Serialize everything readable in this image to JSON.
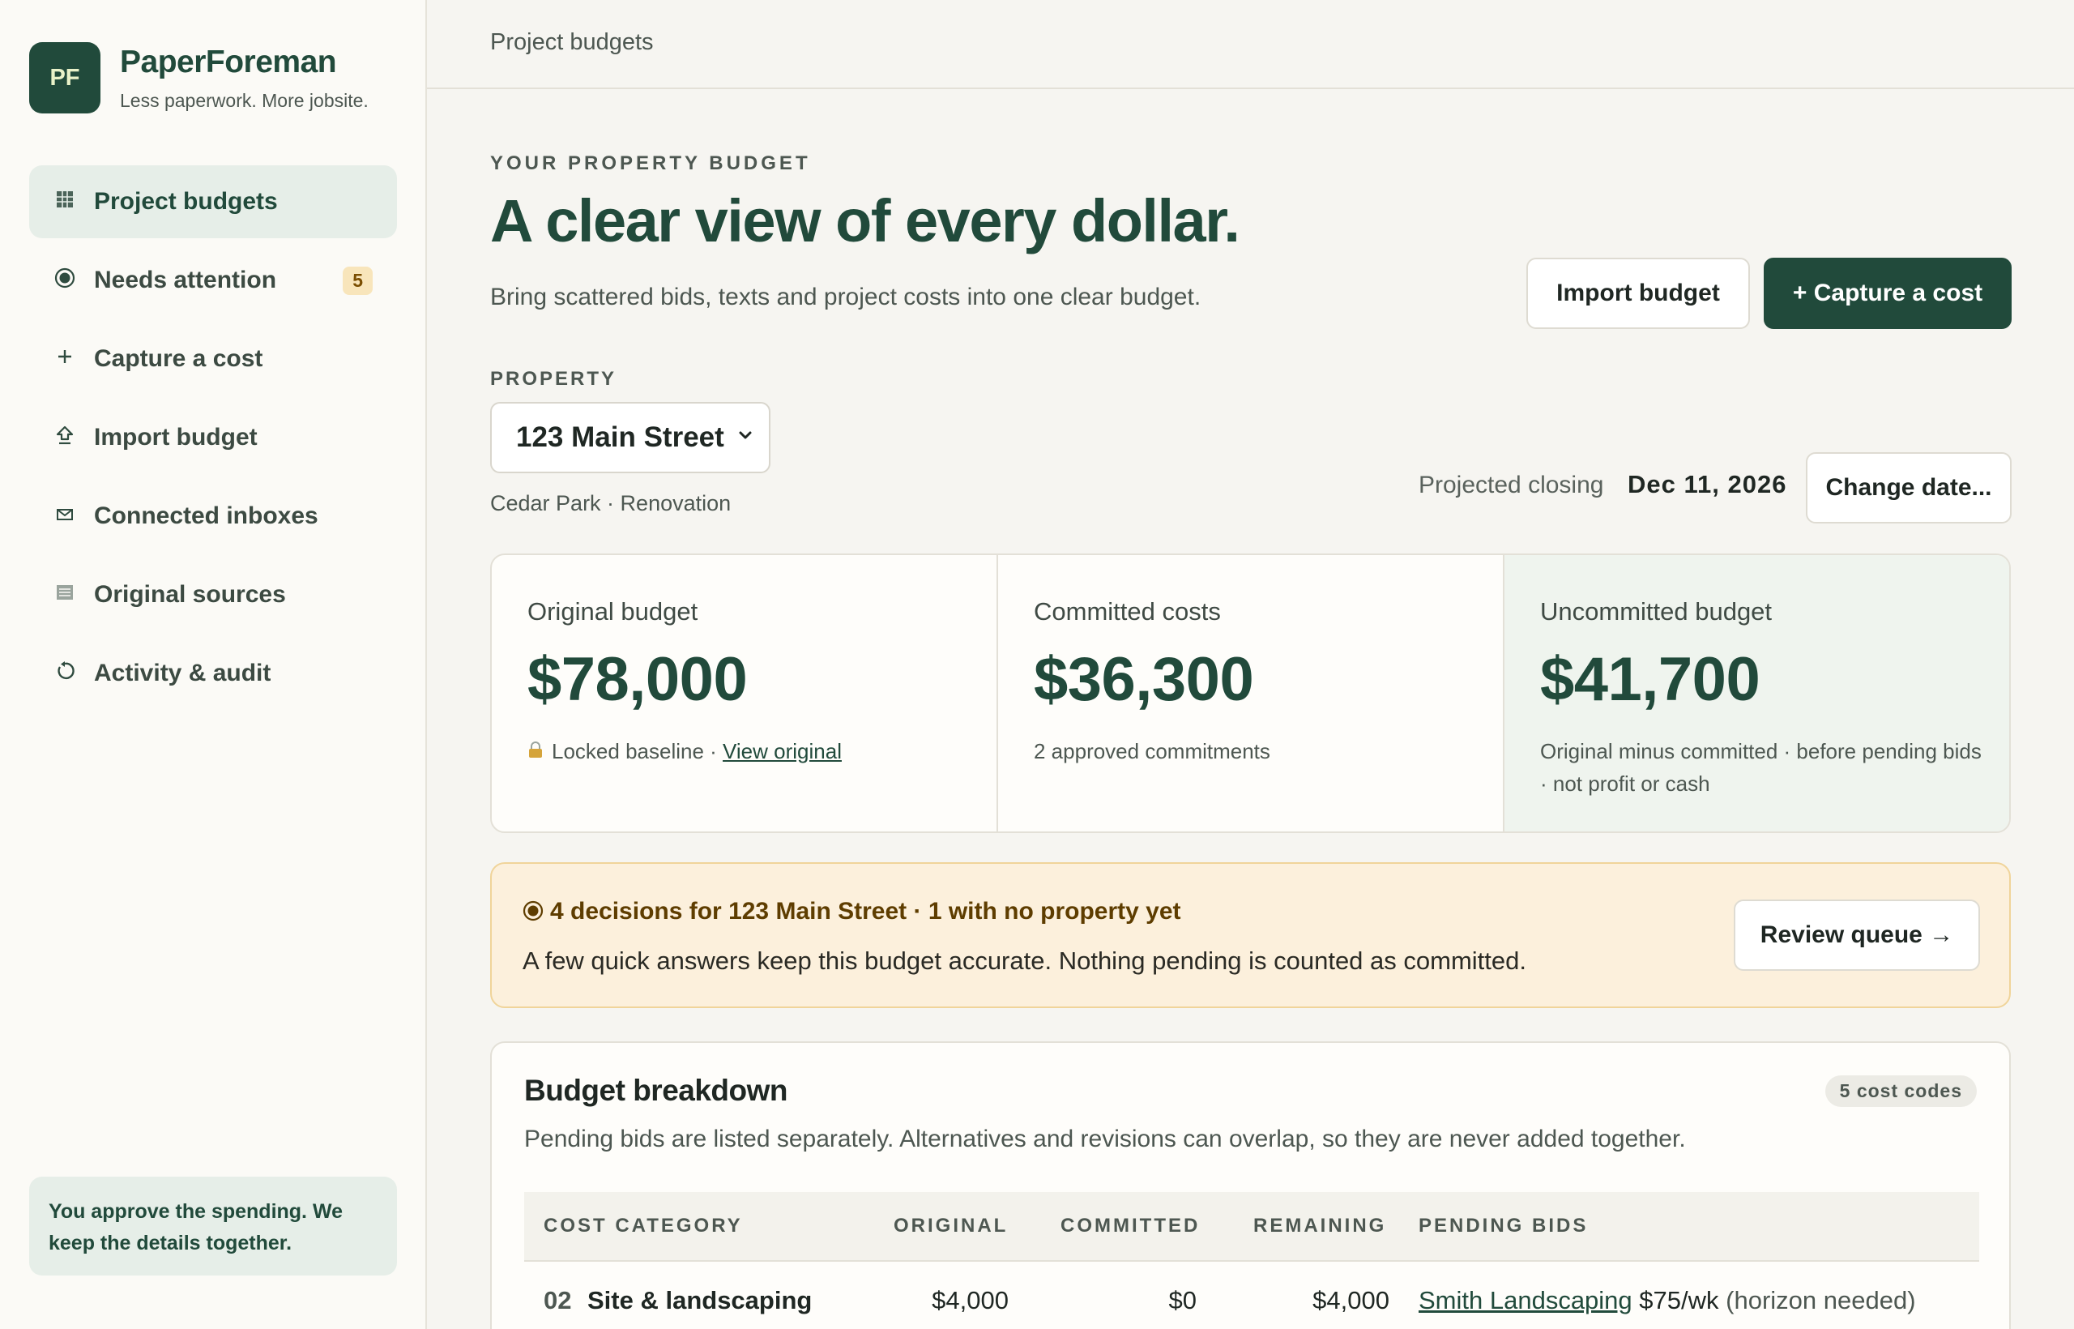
{
  "brand": {
    "initials": "PF",
    "name": "PaperForeman",
    "tagline": "Less paperwork. More jobsite."
  },
  "nav": [
    {
      "label": "Project budgets",
      "icon": "grid-icon",
      "active": true
    },
    {
      "label": "Needs attention",
      "icon": "target-icon",
      "badge": "5"
    },
    {
      "label": "Capture a cost",
      "icon": "plus-icon"
    },
    {
      "label": "Import budget",
      "icon": "upload-icon"
    },
    {
      "label": "Connected inboxes",
      "icon": "envelope-icon"
    },
    {
      "label": "Original sources",
      "icon": "document-icon"
    },
    {
      "label": "Activity & audit",
      "icon": "history-icon"
    }
  ],
  "sidebar_note": "You approve the spending. We keep the details together.",
  "topbar": {
    "title": "Project budgets"
  },
  "hero": {
    "eyebrow": "YOUR PROPERTY BUDGET",
    "headline": "A clear view of every dollar.",
    "subline": "Bring scattered bids, texts and project costs into one clear budget.",
    "import_label": "Import budget",
    "capture_label": "+ Capture a cost"
  },
  "property": {
    "label": "PROPERTY",
    "selected": "123 Main Street",
    "sub": "Cedar Park · Renovation",
    "closing_label": "Projected closing",
    "closing_date": "Dec 11, 2026",
    "change_date_label": "Change date..."
  },
  "stats": {
    "original": {
      "title": "Original budget",
      "value": "$78,000",
      "note_prefix": "Locked baseline · ",
      "note_link": "View original"
    },
    "committed": {
      "title": "Committed costs",
      "value": "$36,300",
      "note": "2 approved commitments"
    },
    "uncommitted": {
      "title": "Uncommitted budget",
      "value": "$41,700",
      "note": "Original minus committed · before pending bids · not profit or cash"
    }
  },
  "alert": {
    "title": "4 decisions for 123 Main Street · 1 with no property yet",
    "body": "A few quick answers keep this budget accurate. Nothing pending is counted as committed.",
    "button": "Review queue →"
  },
  "breakdown": {
    "title": "Budget breakdown",
    "badge": "5 cost codes",
    "sub": "Pending bids are listed separately. Alternatives and revisions can overlap, so they are never added together.",
    "columns": [
      "COST CATEGORY",
      "ORIGINAL",
      "COMMITTED",
      "REMAINING",
      "PENDING BIDS"
    ],
    "rows": [
      {
        "code": "02",
        "category": "Site & landscaping",
        "original": "$4,000",
        "committed": "$0",
        "remaining": "$4,000",
        "pending_link": "Smith Landscaping",
        "pending_amount": "$75/wk",
        "pending_note": "(horizon needed)"
      }
    ]
  },
  "colors": {
    "brand": "#214a3b",
    "alert_bg": "#fcf0dc",
    "accent_soft": "#e6eee8"
  }
}
